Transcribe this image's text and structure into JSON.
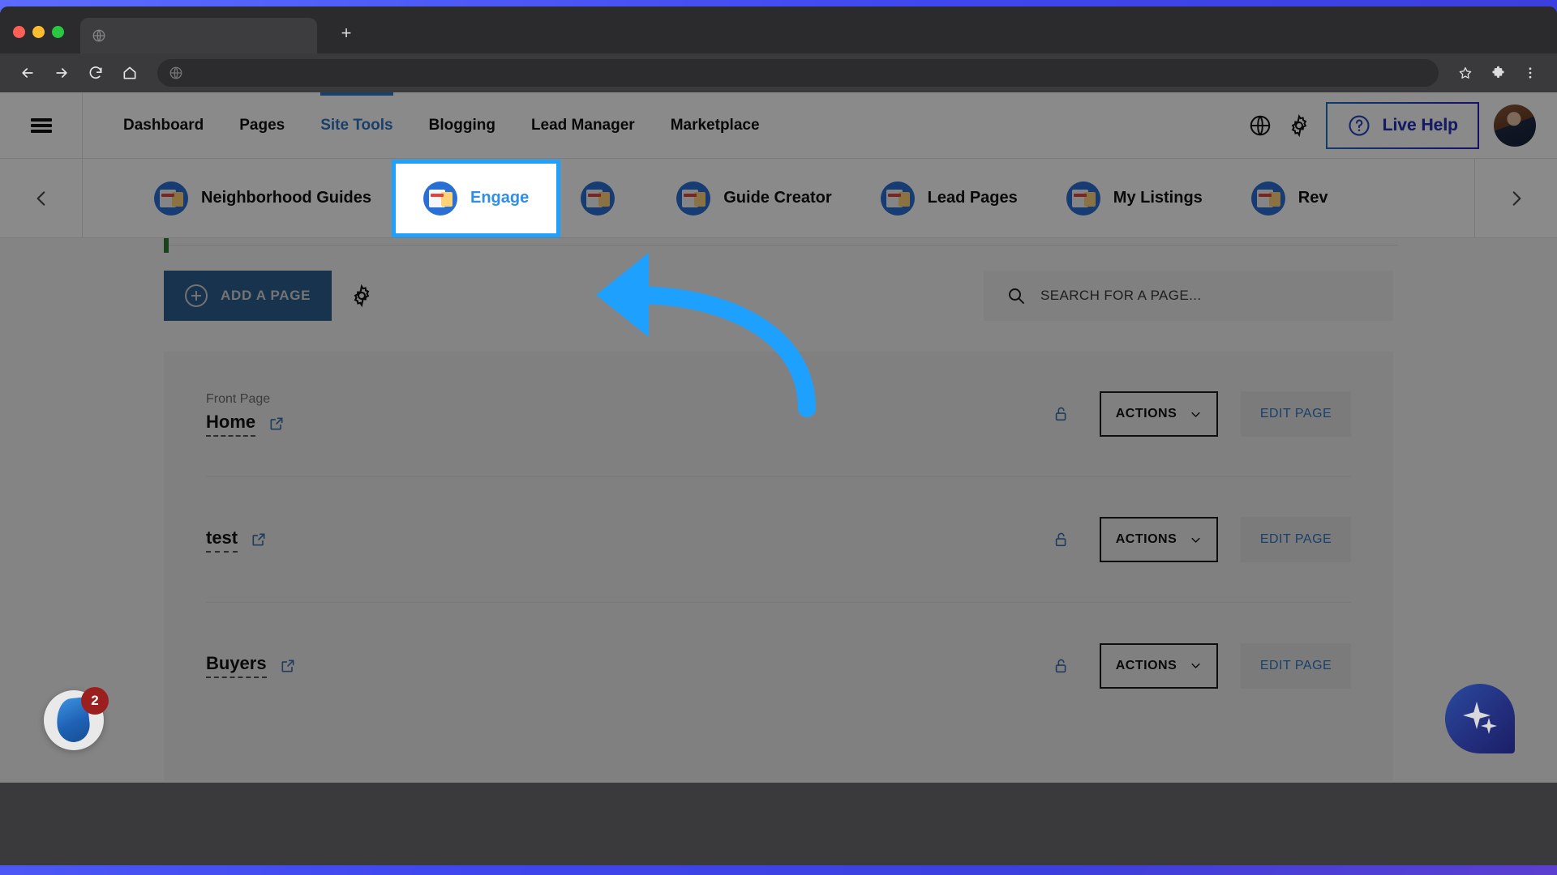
{
  "browser": {
    "tab_title": "",
    "favicon_icon": "globe-icon",
    "new_tab_label": "+",
    "back_icon": "arrow-left-icon",
    "forward_icon": "arrow-right-icon",
    "reload_icon": "reload-icon",
    "home_icon": "home-icon",
    "omnibox_url": "",
    "omnibox_icon": "globe-icon",
    "bookmark_icon": "star-icon",
    "extensions_icon": "puzzle-icon",
    "menu_icon": "kebab-menu-icon"
  },
  "header": {
    "hamburger_icon": "hamburger-menu-icon",
    "nav": [
      {
        "label": "Dashboard",
        "active": false
      },
      {
        "label": "Pages",
        "active": false
      },
      {
        "label": "Site Tools",
        "active": true
      },
      {
        "label": "Blogging",
        "active": false
      },
      {
        "label": "Lead Manager",
        "active": false
      },
      {
        "label": "Marketplace",
        "active": false
      }
    ],
    "globe_icon": "globe-icon",
    "settings_icon": "gear-icon",
    "live_help_label": "Live Help",
    "live_help_icon": "question-circle-icon",
    "avatar_name": "user-avatar"
  },
  "carousel": {
    "prev_icon": "chevron-left-icon",
    "next_icon": "chevron-right-icon",
    "items": [
      {
        "label": "Neighborhood Guides",
        "highlighted": false
      },
      {
        "label": "Engage",
        "highlighted": true
      },
      {
        "label": "",
        "highlighted": false
      },
      {
        "label": "Guide Creator",
        "highlighted": false
      },
      {
        "label": "Lead Pages",
        "highlighted": false
      },
      {
        "label": "My Listings",
        "highlighted": false
      },
      {
        "label": "Rev",
        "highlighted": false
      }
    ],
    "highlight_color": "#1ea0ff"
  },
  "toolbar": {
    "add_page_label": "ADD A PAGE",
    "add_page_icon": "plus-circle-icon",
    "settings_icon": "gear-icon",
    "search_icon": "search-icon",
    "search_placeholder": "SEARCH FOR A PAGE...",
    "search_value": ""
  },
  "pages_list": {
    "rows": [
      {
        "tag": "Front Page",
        "title": "Home",
        "external_icon": "external-link-icon",
        "lock_icon": "unlock-icon",
        "actions_label": "ACTIONS",
        "actions_caret": "chevron-down-icon",
        "edit_label": "EDIT PAGE"
      },
      {
        "tag": "",
        "title": "test",
        "external_icon": "external-link-icon",
        "lock_icon": "unlock-icon",
        "actions_label": "ACTIONS",
        "actions_caret": "chevron-down-icon",
        "edit_label": "EDIT PAGE"
      },
      {
        "tag": "",
        "title": "Buyers",
        "external_icon": "external-link-icon",
        "lock_icon": "unlock-icon",
        "actions_label": "ACTIONS",
        "actions_caret": "chevron-down-icon",
        "edit_label": "EDIT PAGE"
      }
    ]
  },
  "widgets": {
    "chat_badge_count": "2",
    "chat_icon": "flame-chat-icon",
    "ai_icon": "sparkle-icon"
  },
  "annotation": {
    "arrow_color": "#1ea0ff",
    "arrow_name": "pointer-arrow-to-engage"
  }
}
